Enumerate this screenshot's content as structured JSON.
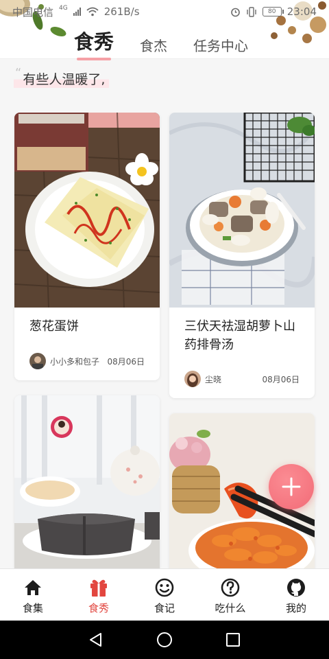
{
  "status_bar": {
    "carrier": "中国电信",
    "network": "4G",
    "speed": "261B/s",
    "battery": "80",
    "time": "23:04"
  },
  "top_tabs": [
    {
      "label": "食秀",
      "active": true
    },
    {
      "label": "食杰",
      "active": false
    },
    {
      "label": "任务中心",
      "active": false
    }
  ],
  "quote": {
    "text": "有些人温暖了,"
  },
  "cards": [
    {
      "title": "葱花蛋饼",
      "author": "小小多和包子",
      "date": "08月06日",
      "image_icon": "scallion-pancake-photo"
    },
    {
      "title": "三伏天祛湿胡萝卜山药排骨汤",
      "author": "尘晓",
      "date": "08月06日",
      "image_icon": "rib-soup-photo"
    },
    {
      "title": "",
      "author": "",
      "date": "",
      "image_icon": "black-sesame-cake-photo"
    },
    {
      "title": "",
      "author": "",
      "date": "",
      "image_icon": "fried-shrimp-photo"
    }
  ],
  "fab": {
    "icon": "plus-icon",
    "color": "#f26b77"
  },
  "bottom_nav": [
    {
      "label": "食集",
      "icon": "home-icon",
      "active": false
    },
    {
      "label": "食秀",
      "icon": "gift-icon",
      "active": true
    },
    {
      "label": "食记",
      "icon": "smile-icon",
      "active": false
    },
    {
      "label": "吃什么",
      "icon": "question-icon",
      "active": false
    },
    {
      "label": "我的",
      "icon": "github-icon",
      "active": false
    }
  ],
  "colors": {
    "accent": "#e2463f",
    "tab_underline": "#f5a0a6",
    "quote_highlight": "#fde6e9"
  }
}
